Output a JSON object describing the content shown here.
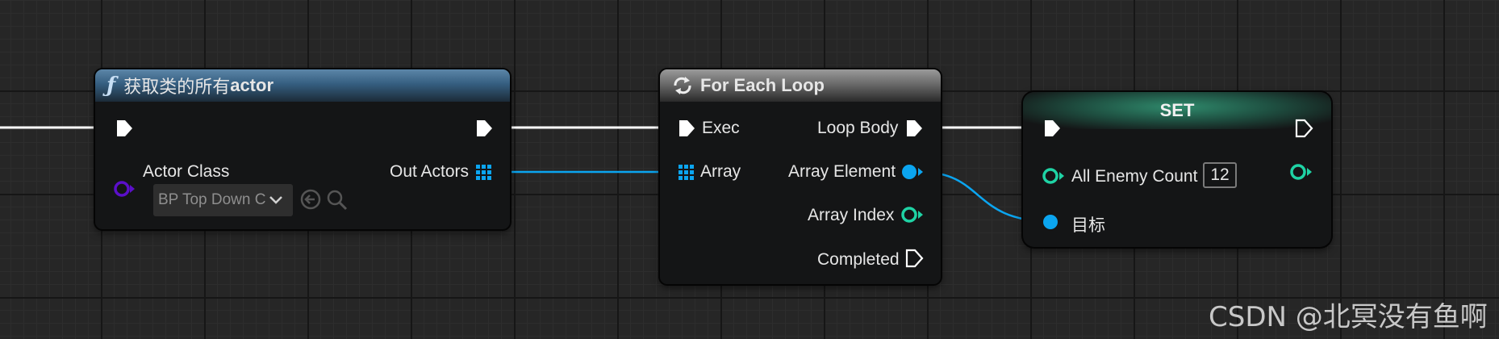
{
  "nodes": {
    "get_all_actors": {
      "title_icon": "ƒ",
      "title_prefix": "获取类的所有",
      "title_suffix": "actor",
      "actor_class_label": "Actor Class",
      "actor_class_value": "BP Top Down C",
      "out_actors_label": "Out Actors",
      "icons": [
        "function-icon",
        "exec-in-pin-icon",
        "exec-out-pin-icon",
        "class-pin-icon",
        "chevron-down-icon",
        "use-selected-arrow-icon",
        "browse-magnifier-icon",
        "array-grid-icon"
      ]
    },
    "for_each_loop": {
      "title": "For Each Loop",
      "exec_label": "Exec",
      "array_label": "Array",
      "loop_body_label": "Loop Body",
      "array_element_label": "Array Element",
      "array_index_label": "Array Index",
      "completed_label": "Completed",
      "icons": [
        "loop-icon",
        "exec-in-pin-icon",
        "array-grid-icon",
        "exec-out-pin-icon",
        "object-pin-icon",
        "integer-pin-icon"
      ]
    },
    "set_node": {
      "title": "SET",
      "variable_label": "All Enemy Count",
      "variable_value": "12",
      "target_label": "目标",
      "icons": [
        "exec-in-pin-icon",
        "exec-out-pin-icon",
        "integer-pin-icon",
        "object-pin-icon"
      ]
    }
  },
  "colors": {
    "background": "#262626",
    "exec_wire": "#ffffff",
    "object_pin": "#0ba5f0",
    "integer_pin": "#1fd3a5",
    "class_pin": "#5b0fc9",
    "function_header": "#355e80",
    "loop_header": "#6a6a6a",
    "set_header": "#2f8a6c"
  },
  "watermark": "CSDN @北冥没有鱼啊"
}
